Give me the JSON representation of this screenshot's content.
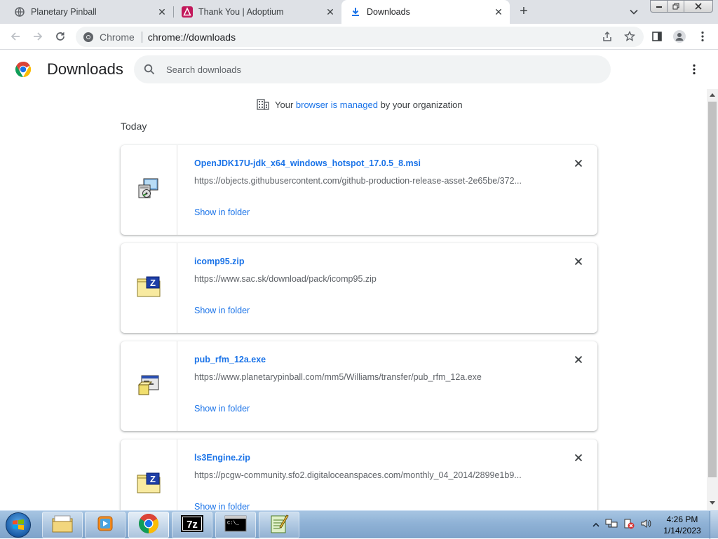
{
  "tabs": [
    {
      "title": "Planetary Pinball",
      "icon": "globe-icon",
      "active": false
    },
    {
      "title": "Thank You | Adoptium",
      "icon": "adoptium-icon",
      "active": false
    },
    {
      "title": "Downloads",
      "icon": "download-icon",
      "active": true
    }
  ],
  "omnibox": {
    "scheme_label": "Chrome",
    "url": "chrome://downloads"
  },
  "page": {
    "title": "Downloads",
    "search_placeholder": "Search downloads",
    "managed": {
      "prefix": "Your ",
      "link": "browser is managed",
      "suffix": " by your organization"
    },
    "date_group": "Today"
  },
  "downloads": [
    {
      "file_name": "OpenJDK17U-jdk_x64_windows_hotspot_17.0.5_8.msi",
      "url": "https://objects.githubusercontent.com/github-production-release-asset-2e65be/372...",
      "action": "Show in folder",
      "icon": "msi-installer-icon"
    },
    {
      "file_name": "icomp95.zip",
      "url": "https://www.sac.sk/download/pack/icomp95.zip",
      "action": "Show in folder",
      "icon": "zip-archive-icon"
    },
    {
      "file_name": "pub_rfm_12a.exe",
      "url": "https://www.planetarypinball.com/mm5/Williams/transfer/pub_rfm_12a.exe",
      "action": "Show in folder",
      "icon": "exe-application-icon"
    },
    {
      "file_name": "ls3Engine.zip",
      "url": "https://pcgw-community.sfo2.digitaloceanspaces.com/monthly_04_2014/2899e1b9...",
      "action": "Show in folder",
      "icon": "zip-archive-icon"
    }
  ],
  "taskbar": {
    "apps": [
      "windows-explorer-icon",
      "media-player-icon",
      "chrome-icon",
      "7zip-icon",
      "command-prompt-icon",
      "notepad-icon"
    ],
    "clock_time": "4:26 PM",
    "clock_date": "1/14/2023"
  },
  "colors": {
    "accent": "#1a73e8",
    "tabstrip": "#dee1e6",
    "searchbox": "#f1f3f4"
  }
}
